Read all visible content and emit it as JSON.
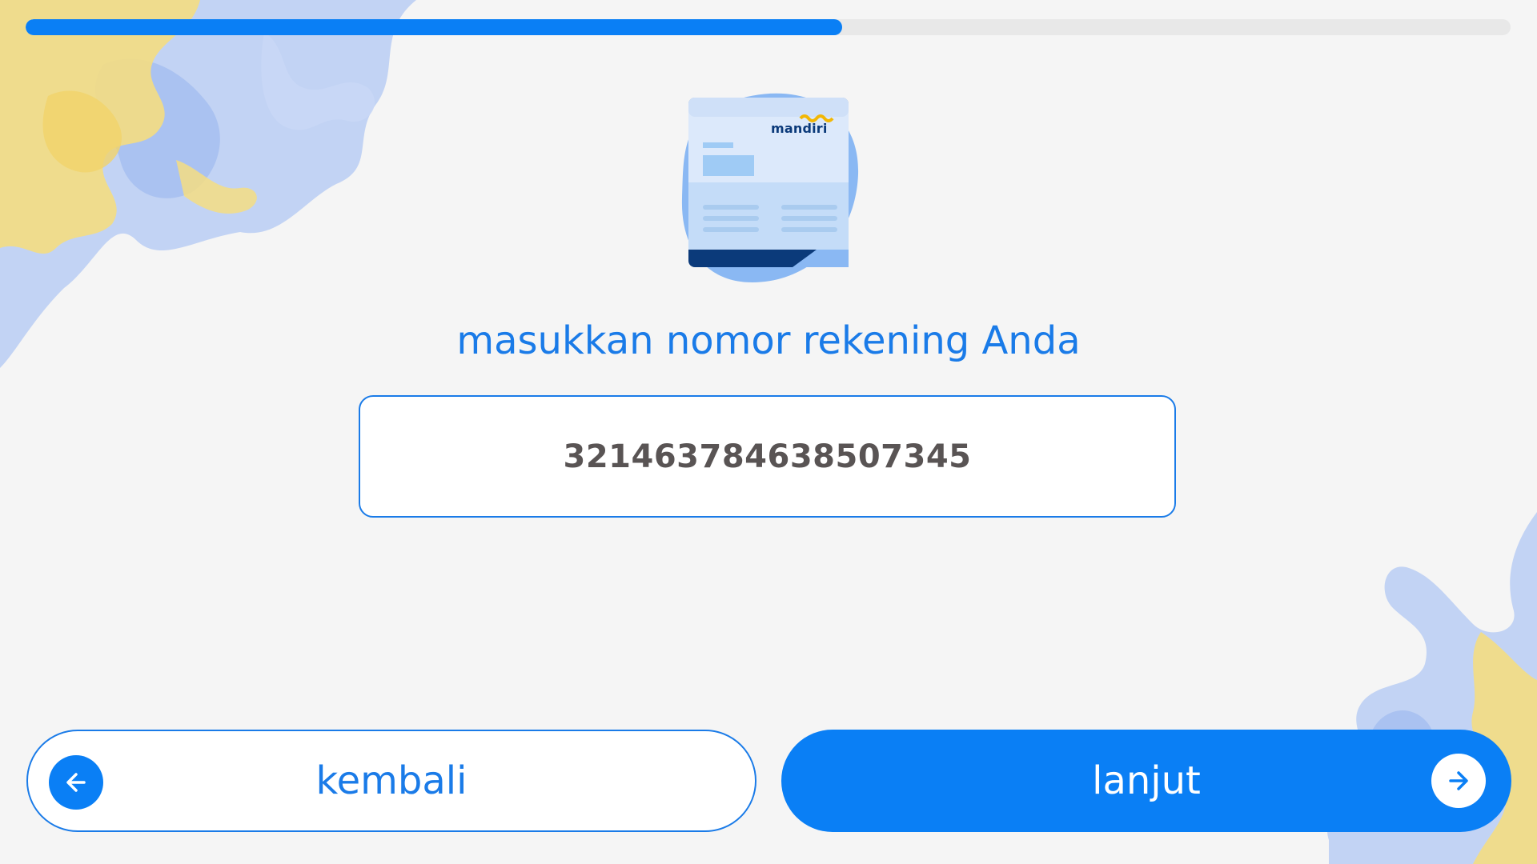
{
  "progress": {
    "fraction": 0.55
  },
  "illustration": {
    "bank_logo_text": "mandiri"
  },
  "prompt": {
    "title": "masukkan nomor rekening Anda"
  },
  "account_field": {
    "value": "321463784638507345"
  },
  "buttons": {
    "back_label": "kembali",
    "next_label": "lanjut"
  },
  "icons": {
    "back": "arrow-left-icon",
    "next": "arrow-right-icon"
  },
  "colors": {
    "accent": "#0a7ff5",
    "text_blue": "#1a7be8",
    "value_text": "#595454",
    "background": "#f5f5f5"
  }
}
